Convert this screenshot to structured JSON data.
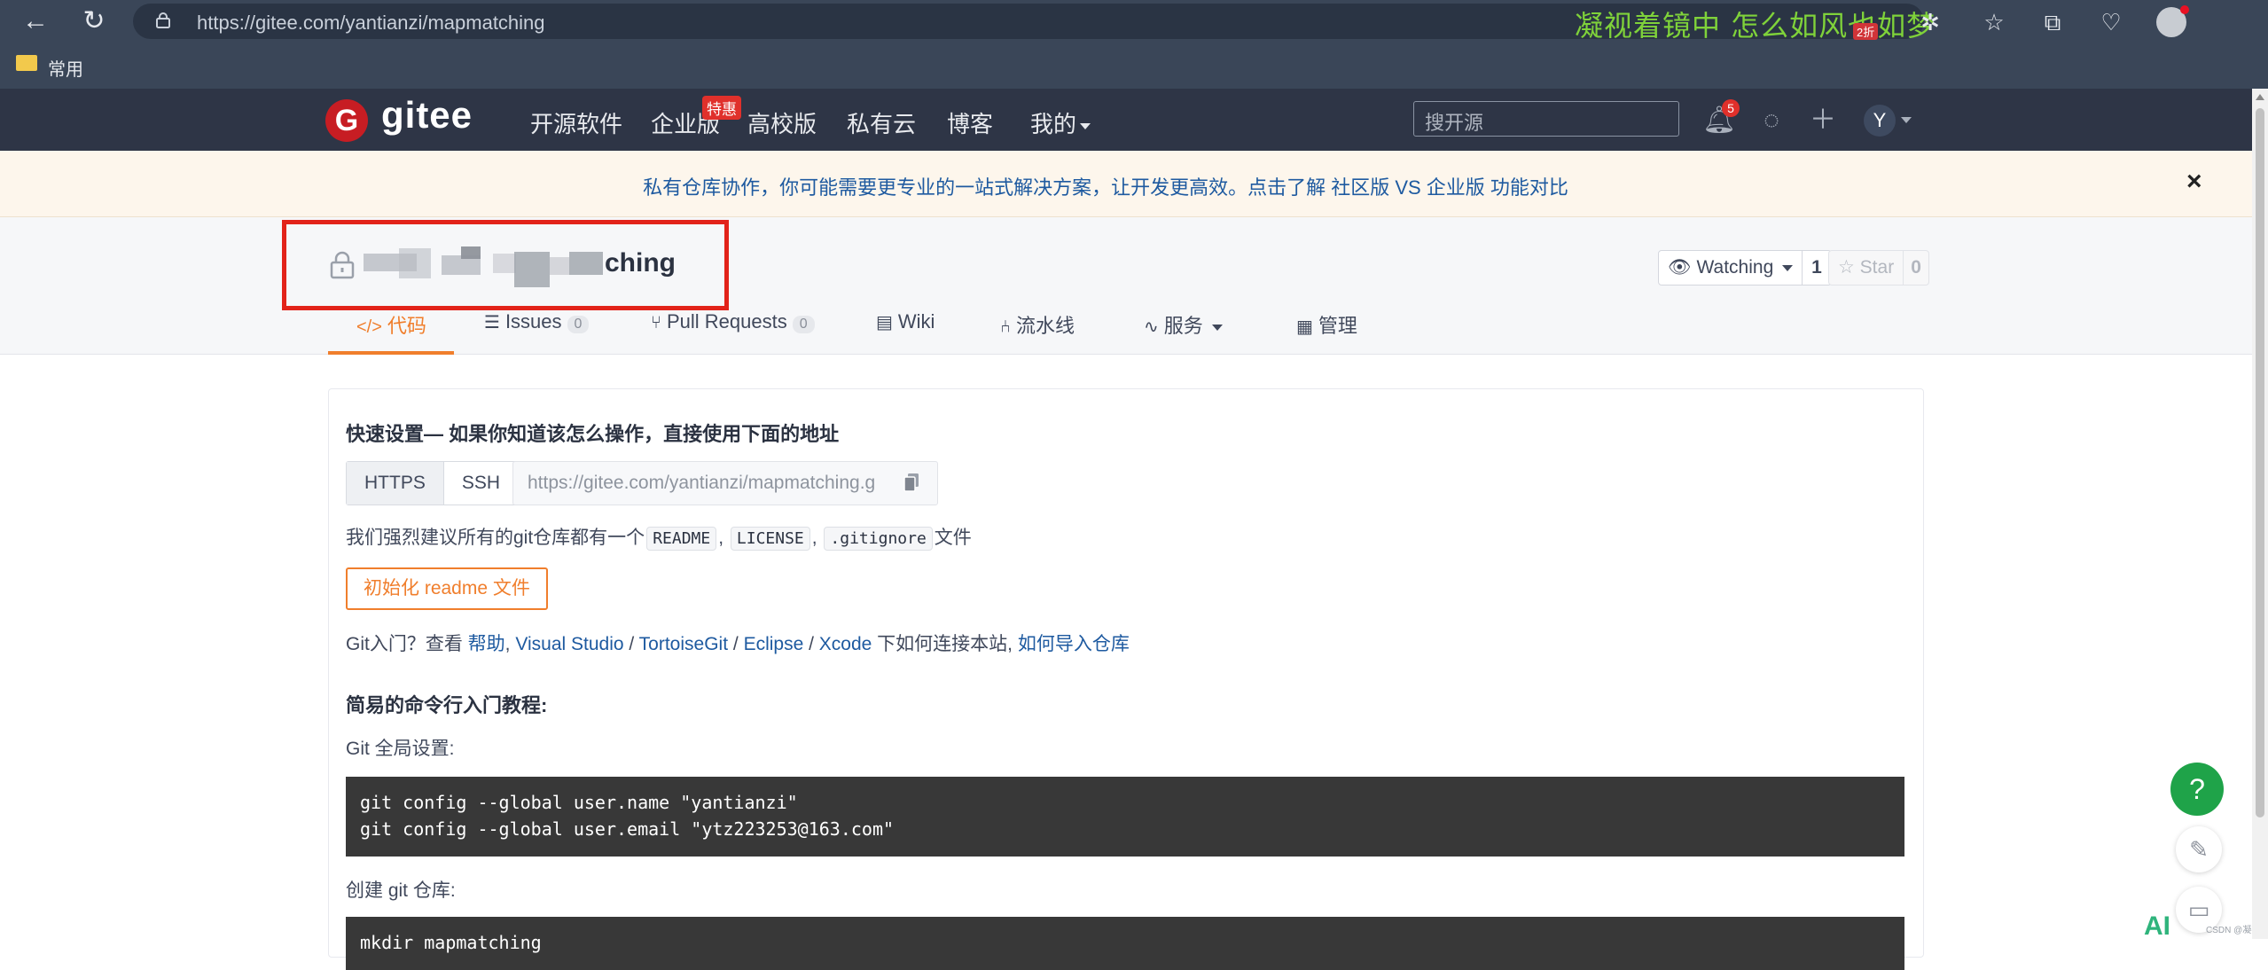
{
  "browser": {
    "url": "https://gitee.com/yantianzi/mapmatching",
    "marquee": "凝视着镜中  怎么如风也如梦",
    "ext_badge": "2折",
    "bookmark_folder": "常用"
  },
  "header": {
    "logo_letter": "G",
    "logo_text": "gitee",
    "nav": [
      "开源软件",
      "企业版",
      "高校版",
      "私有云",
      "博客",
      "我的"
    ],
    "enterprise_badge": "特惠",
    "search_placeholder": "搜开源",
    "notification_count": "5",
    "avatar_letter": "Y"
  },
  "notice": {
    "text": "私有仓库协作，你可能需要更专业的一站式解决方案，让开发更高效。点击了解 社区版 VS 企业版 功能对比",
    "close": "×"
  },
  "repo": {
    "name_visible": "ching",
    "watch_label": "Watching",
    "watch_count": "1",
    "star_label": "Star",
    "star_count": "0"
  },
  "tabs": [
    {
      "icon": "</>",
      "label": "代码"
    },
    {
      "icon": "☰",
      "label": "Issues",
      "count": "0"
    },
    {
      "icon": "⑂",
      "label": "Pull Requests",
      "count": "0"
    },
    {
      "icon": "▤",
      "label": "Wiki"
    },
    {
      "icon": "⑃",
      "label": "流水线"
    },
    {
      "icon": "∿",
      "label": "服务"
    },
    {
      "icon": "▦",
      "label": "管理"
    }
  ],
  "quick": {
    "heading": "快速设置— 如果你知道该怎么操作，直接使用下面的地址",
    "protocols": [
      "HTTPS",
      "SSH"
    ],
    "clone_url": "https://gitee.com/yantianzi/mapmatching.g",
    "rec_prefix": "我们强烈建议所有的git仓库都有一个",
    "rec_files": [
      "README",
      "LICENSE",
      ".gitignore"
    ],
    "rec_suffix": "文件",
    "init_button": "初始化 readme 文件",
    "intro_prefix": "Git入门？查看 ",
    "intro_links": [
      "帮助",
      "Visual Studio",
      "TortoiseGit",
      "Eclipse",
      "Xcode"
    ],
    "intro_mid": " 下如何连接本站, ",
    "intro_last_link": "如何导入仓库"
  },
  "cli": {
    "heading": "简易的命令行入门教程:",
    "global_label": "Git 全局设置:",
    "global_lines": [
      "git config --global user.name \"yantianzi\"",
      "git config --global user.email \"ytz223253@163.com\""
    ],
    "create_label": "创建 git 仓库:",
    "create_lines": [
      "mkdir mapmatching"
    ]
  },
  "floating": {
    "help": "?",
    "ai": "AI",
    "watermark": "CSDN @凝视"
  }
}
